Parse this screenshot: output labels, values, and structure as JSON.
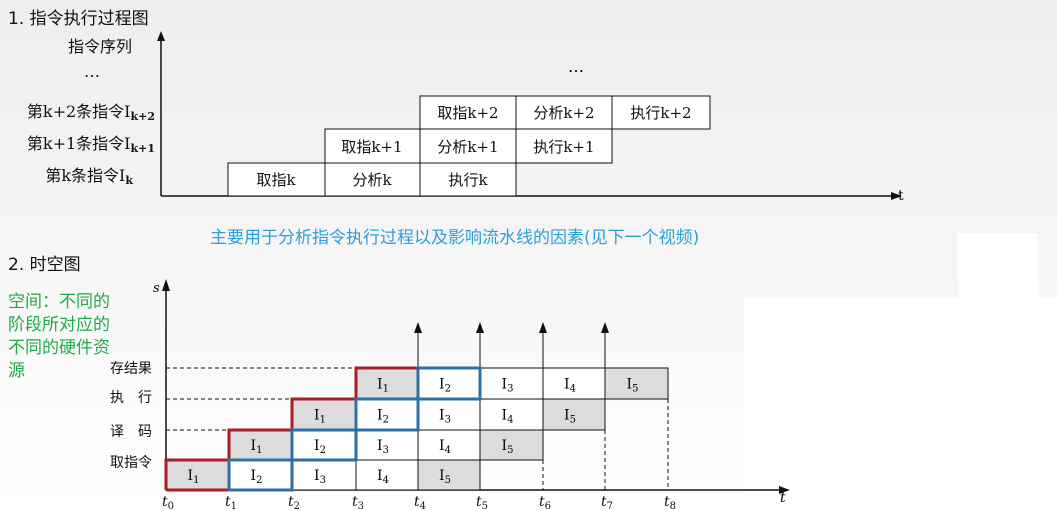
{
  "section1": {
    "title": "1. 指令执行过程图",
    "y_axis_label": "指令序列",
    "top_dots": "…",
    "grid_dots": "…",
    "x_axis_label": "t",
    "rows": [
      {
        "prefix": "第k+2条指令I",
        "sub": "k+2"
      },
      {
        "prefix": "第k+1条指令I",
        "sub": "k+1"
      },
      {
        "prefix": "第k条指令I",
        "sub": "k"
      }
    ],
    "cells": [
      [
        "取指k+2",
        "分析k+2",
        "执行k+2"
      ],
      [
        "取指k+1",
        "分析k+1",
        "执行k+1"
      ],
      [
        "取指k",
        "分析k",
        "执行k"
      ]
    ]
  },
  "tip": "主要用于分析指令执行过程以及影响流水线的因素(见下一个视频)",
  "section2": {
    "title": "2. 时空图",
    "note": "空间：不同的阶段所对应的不同的硬件资源",
    "y_axis_label": "s",
    "x_axis_label": "t",
    "stages": [
      "存结果",
      "执　行",
      "译　码",
      "取指令"
    ],
    "time_labels": [
      "t0",
      "t1",
      "t2",
      "t3",
      "t4",
      "t5",
      "t6",
      "t7",
      "t8"
    ],
    "instructions": [
      "I1",
      "I2",
      "I3",
      "I4",
      "I5"
    ],
    "colors": {
      "highlight_red": "#a51f24",
      "highlight_blue": "#2f6fa8",
      "shaded": "#dcdcdc",
      "tip": "#2aa0d8",
      "note": "#1faa4a"
    }
  }
}
